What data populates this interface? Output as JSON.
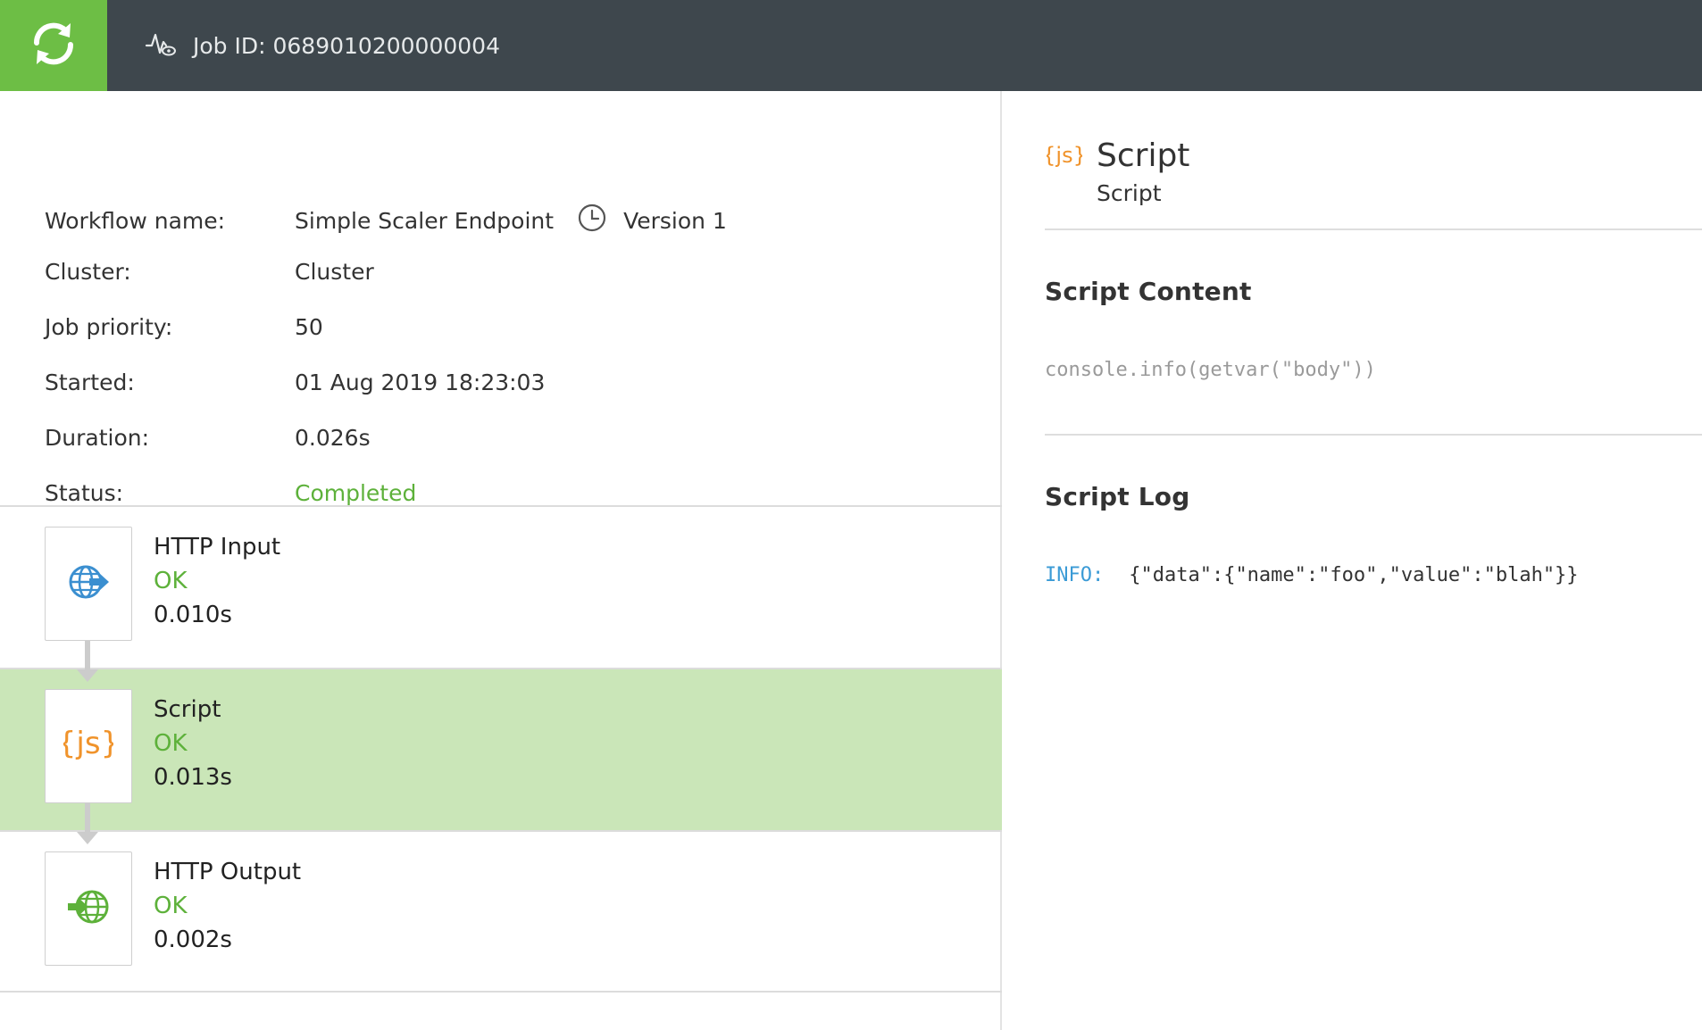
{
  "header": {
    "job_label": "Job ID: 0689010200000004",
    "colors": {
      "bar": "#3e474d",
      "logo_bg": "#6dbe45"
    },
    "icons": {
      "logo": "sync-icon",
      "activity": "activity-eye-icon"
    }
  },
  "job": {
    "workflow_label": "Workflow name:",
    "workflow_value": "Simple Scaler Endpoint",
    "version_value": "Version 1",
    "cluster_label": "Cluster:",
    "cluster_value": "Cluster",
    "priority_label": "Job priority:",
    "priority_value": "50",
    "started_label": "Started:",
    "started_value": "01 Aug 2019 18:23:03",
    "duration_label": "Duration:",
    "duration_value": "0.026s",
    "status_label": "Status:",
    "status_value": "Completed",
    "status_color": "#5db13a"
  },
  "steps": [
    {
      "title": "HTTP Input",
      "status": "OK",
      "duration": "0.010s",
      "icon": "http-input-globe-icon",
      "selected": false
    },
    {
      "title": "Script",
      "status": "OK",
      "duration": "0.013s",
      "icon": "js-script-icon",
      "selected": true
    },
    {
      "title": "HTTP Output",
      "status": "OK",
      "duration": "0.002s",
      "icon": "http-output-globe-icon",
      "selected": false
    }
  ],
  "detail": {
    "title": "Script",
    "subtitle": "Script",
    "content_heading": "Script Content",
    "content_code": "console.info(getvar(\"body\"))",
    "log_heading": "Script Log",
    "log_level": "INFO:",
    "log_message": "{\"data\":{\"name\":\"foo\",\"value\":\"blah\"}}"
  }
}
